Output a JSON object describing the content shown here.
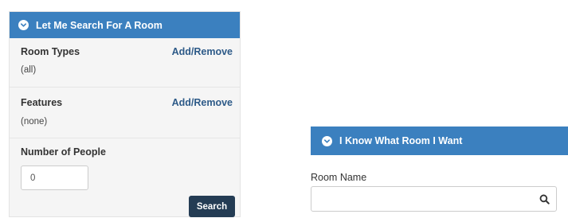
{
  "left_panel": {
    "title": "Let Me Search For A Room",
    "room_types": {
      "label": "Room Types",
      "link": "Add/Remove",
      "value": "(all)"
    },
    "features": {
      "label": "Features",
      "link": "Add/Remove",
      "value": "(none)"
    },
    "people": {
      "label": "Number of People",
      "value": "0"
    },
    "search_button": "Search"
  },
  "right_panel": {
    "title": "I Know What Room I Want",
    "room_name_label": "Room Name",
    "room_name_value": "",
    "search_icon": "magnifier-icon"
  },
  "colors": {
    "header_blue": "#3b80bf",
    "link_blue": "#2d5a88",
    "button_dark": "#243c54",
    "panel_bg": "#f5f5f5"
  }
}
